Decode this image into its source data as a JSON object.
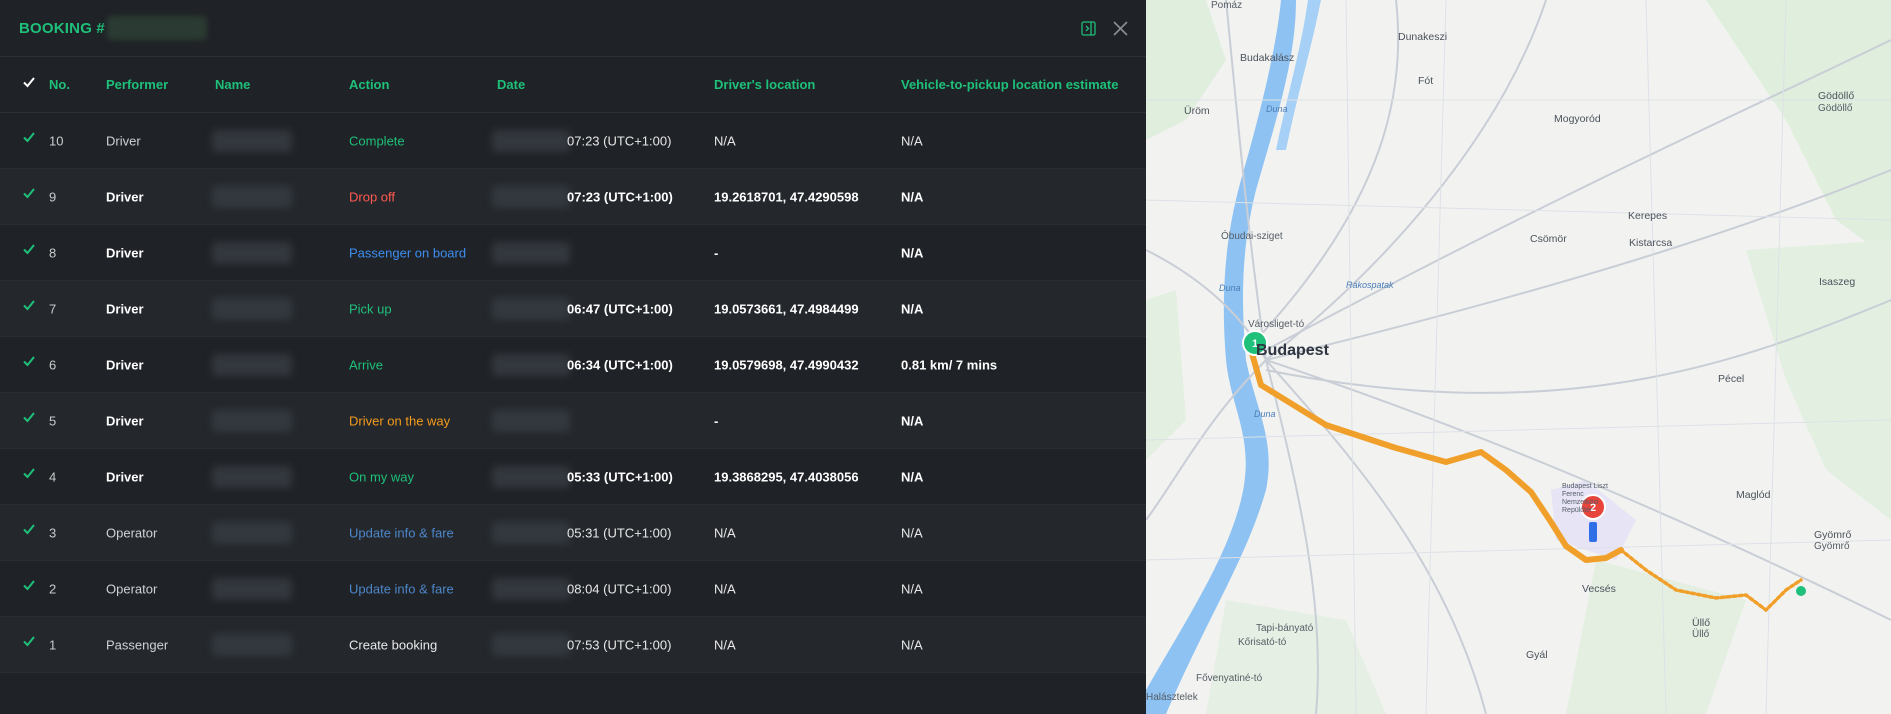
{
  "header": {
    "title": "BOOKING #"
  },
  "columns": {
    "no": "No.",
    "performer": "Performer",
    "name": "Name",
    "action": "Action",
    "date": "Date",
    "driver_location": "Driver's location",
    "estimate": "Vehicle-to-pickup location estimate"
  },
  "rows": [
    {
      "no": "10",
      "performer": "Driver",
      "action": "Complete",
      "action_color": "#1ec07a",
      "date": "07:23 (UTC+1:00)",
      "location": "N/A",
      "estimate": "N/A"
    },
    {
      "no": "9",
      "performer": "Driver",
      "action": "Drop off",
      "action_color": "#ff5a4e",
      "date": "07:23 (UTC+1:00)",
      "location": "19.2618701, 47.4290598",
      "estimate": "N/A"
    },
    {
      "no": "8",
      "performer": "Driver",
      "action": "Passenger on board",
      "action_color": "#3e8ef0",
      "date": "",
      "location": "-",
      "estimate": "N/A"
    },
    {
      "no": "7",
      "performer": "Driver",
      "action": "Pick up",
      "action_color": "#1ec07a",
      "date": "06:47 (UTC+1:00)",
      "location": "19.0573661, 47.4984499",
      "estimate": "N/A"
    },
    {
      "no": "6",
      "performer": "Driver",
      "action": "Arrive",
      "action_color": "#1ec07a",
      "date": "06:34 (UTC+1:00)",
      "location": "19.0579698, 47.4990432",
      "estimate": "0.81 km/ 7 mins"
    },
    {
      "no": "5",
      "performer": "Driver",
      "action": "Driver on the way",
      "action_color": "#f59b1b",
      "date": "",
      "location": "-",
      "estimate": "N/A"
    },
    {
      "no": "4",
      "performer": "Driver",
      "action": "On my way",
      "action_color": "#1ec07a",
      "date": "05:33 (UTC+1:00)",
      "location": "19.3868295, 47.4038056",
      "estimate": "N/A"
    },
    {
      "no": "3",
      "performer": "Operator",
      "action": "Update info & fare",
      "action_color": "#4d86c9",
      "date": "05:31 (UTC+1:00)",
      "location": "N/A",
      "estimate": "N/A"
    },
    {
      "no": "2",
      "performer": "Operator",
      "action": "Update info & fare",
      "action_color": "#4d86c9",
      "date": "08:04 (UTC+1:00)",
      "location": "N/A",
      "estimate": "N/A"
    },
    {
      "no": "1",
      "performer": "Passenger",
      "action": "Create booking",
      "action_color": "#e8e8e8",
      "date": "07:53 (UTC+1:00)",
      "location": "N/A",
      "estimate": "N/A"
    }
  ],
  "map": {
    "labels": [
      "Pomáz",
      "Budakalász",
      "Dunakeszi",
      "Fót",
      "Üröm",
      "Mogyoród",
      "Gödöllő",
      "Gödöllő",
      "Óbudai-sziget",
      "Csömör",
      "Kerepes",
      "Kistarcsa",
      "Isaszeg",
      "Városliget-tó",
      "Budapest",
      "Pécel",
      "Budapest Liszt Ferenc Nemzetközi Repülőtér",
      "Maglód",
      "Gyömrő",
      "Gyömrő",
      "Vecsés",
      "Üllő",
      "Üllő",
      "Gyál",
      "Tapi-bányató",
      "Kőrisató-tó",
      "Fővenyatiné-tó",
      "Halásztelek",
      "Duna",
      "Duna",
      "Duna",
      "Rákospatak"
    ],
    "markers": [
      {
        "label": "1",
        "color": "#1ec07a"
      },
      {
        "label": "2",
        "color": "#e8443a"
      }
    ],
    "route_color": "#f0a02a"
  }
}
